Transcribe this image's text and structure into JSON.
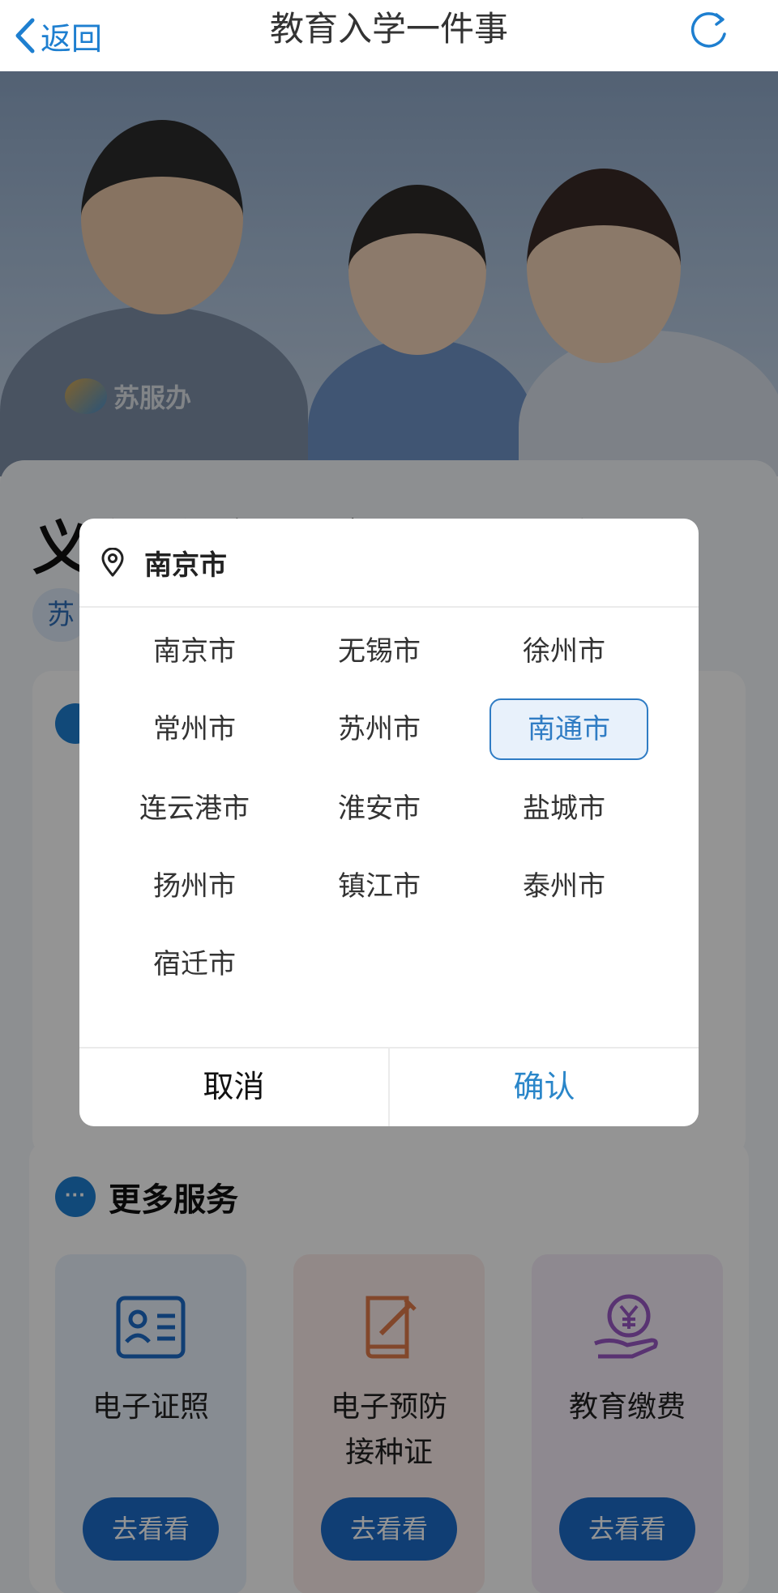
{
  "nav": {
    "back_label": "返回",
    "title": "教育入学一件事"
  },
  "hero": {
    "watermark": "苏服办"
  },
  "page": {
    "section_title": "义务教育入学一件事专区",
    "tag": "苏"
  },
  "more_services": {
    "title": "更多服务",
    "items": [
      {
        "label_line1": "电子证照",
        "label_line2": "",
        "button": "去看看",
        "icon": "id-card-icon"
      },
      {
        "label_line1": "电子预防",
        "label_line2": "接种证",
        "button": "去看看",
        "icon": "vaccine-book-icon"
      },
      {
        "label_line1": "教育缴费",
        "label_line2": "",
        "button": "去看看",
        "icon": "yen-hand-icon"
      }
    ]
  },
  "dialog": {
    "current_city": "南京市",
    "cities": [
      "南京市",
      "无锡市",
      "徐州市",
      "常州市",
      "苏州市",
      "南通市",
      "连云港市",
      "淮安市",
      "盐城市",
      "扬州市",
      "镇江市",
      "泰州市",
      "宿迁市"
    ],
    "selected_city": "南通市",
    "cancel_label": "取消",
    "confirm_label": "确认"
  },
  "colors": {
    "accent": "#1e7fd0",
    "confirm_text": "#2a86c9",
    "selected_border": "#2f7cc4",
    "selected_bg": "#e8f1fb"
  }
}
